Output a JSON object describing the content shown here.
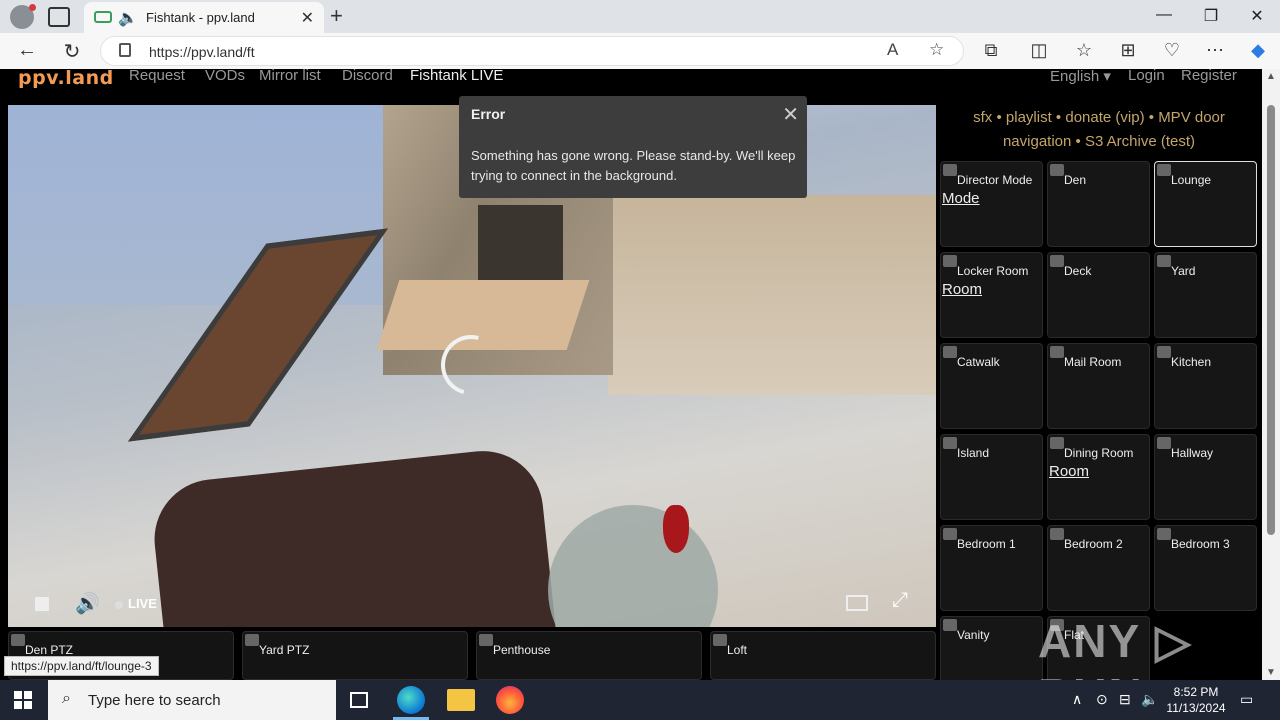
{
  "browser": {
    "tab_title": "Fishtank - ppv.land",
    "url": "https://ppv.land/ft",
    "min_glyph": "—",
    "max_glyph": "❐",
    "close_glyph": "✕",
    "tab_close_glyph": "✕",
    "new_tab_glyph": "+",
    "back_glyph": "←",
    "refresh_glyph": "↻",
    "read_aloud_glyph": "A",
    "favorite_glyph": "☆"
  },
  "site": {
    "logo": "ppv.land",
    "nav": [
      "Request",
      "VODs",
      "Mirror list",
      "Discord",
      "Fishtank LIVE"
    ],
    "language": "English ▾",
    "login": "Login",
    "register": "Register"
  },
  "player": {
    "live_label": "LIVE",
    "volume_glyph": "🔊",
    "fullscreen_glyph": "⤢"
  },
  "error_dialog": {
    "title": "Error",
    "message": "Something has gone wrong. Please stand-by. We'll keep trying to connect in the background.",
    "close_glyph": "✕"
  },
  "sidebar": {
    "links_line1": [
      "sfx",
      "playlist",
      "donate (vip)",
      "MPV door"
    ],
    "links_line2": [
      "navigation",
      "S3 Archive (test)"
    ],
    "separator": "•",
    "cameras": [
      {
        "name": "Director Mode",
        "alt": "Mode"
      },
      {
        "name": "Den",
        "alt": ""
      },
      {
        "name": "Lounge",
        "alt": "",
        "selected": true
      },
      {
        "name": "Locker Room",
        "alt": "Room"
      },
      {
        "name": "Deck",
        "alt": ""
      },
      {
        "name": "Yard",
        "alt": ""
      },
      {
        "name": "Catwalk",
        "alt": ""
      },
      {
        "name": "Mail Room",
        "alt": ""
      },
      {
        "name": "Kitchen",
        "alt": ""
      },
      {
        "name": "Island",
        "alt": ""
      },
      {
        "name": "Dining Room",
        "alt": "Room"
      },
      {
        "name": "Hallway",
        "alt": ""
      },
      {
        "name": "Bedroom 1",
        "alt": ""
      },
      {
        "name": "Bedroom 2",
        "alt": ""
      },
      {
        "name": "Bedroom 3",
        "alt": ""
      },
      {
        "name": "Vanity",
        "alt": ""
      },
      {
        "name": "Flat",
        "alt": ""
      }
    ]
  },
  "bottom_cams": [
    "Den PTZ",
    "Yard PTZ",
    "Penthouse",
    "Loft"
  ],
  "status_url": "https://ppv.land/ft/lounge-3",
  "watermark": "ANY ▷ RUN",
  "taskbar": {
    "search_placeholder": "Type here to search",
    "time": "8:52 PM",
    "date": "11/13/2024"
  }
}
